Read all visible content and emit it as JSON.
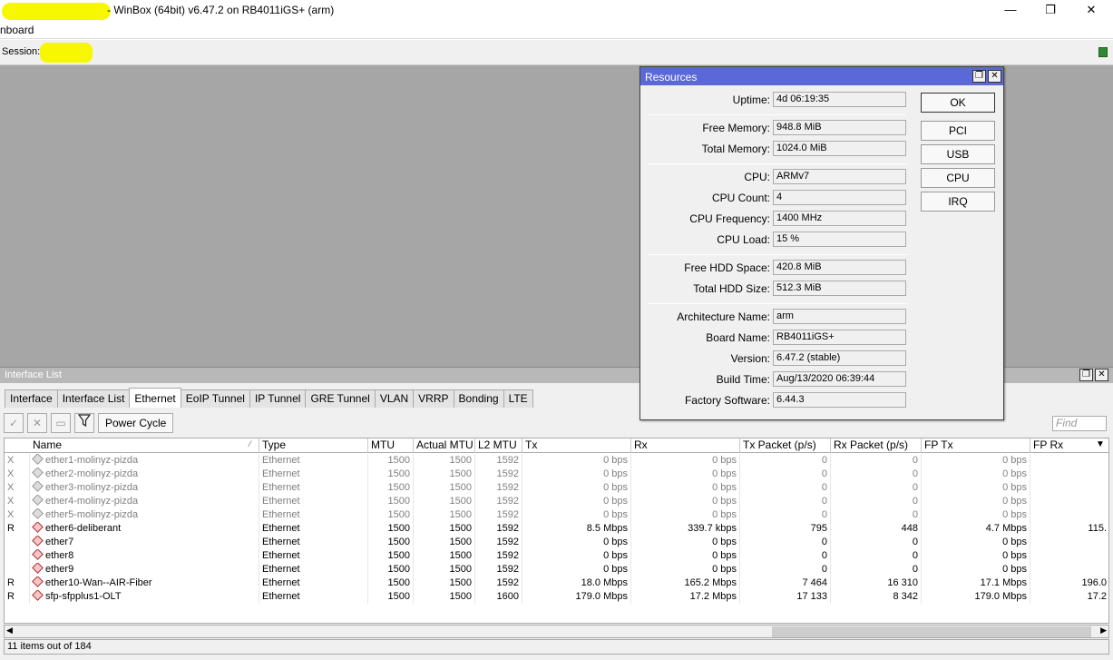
{
  "window": {
    "title": "- WinBox (64bit) v6.47.2 on RB4011iGS+ (arm)",
    "min": "—",
    "max": "❐",
    "close": "✕"
  },
  "menubar": {
    "item": "nboard"
  },
  "session": {
    "label": "Session:"
  },
  "interface_list": {
    "title": "Interface List",
    "tabs": [
      "Interface",
      "Interface List",
      "Ethernet",
      "EoIP Tunnel",
      "IP Tunnel",
      "GRE Tunnel",
      "VLAN",
      "VRRP",
      "Bonding",
      "LTE"
    ],
    "active_tab": "Ethernet",
    "toolbar": {
      "power_cycle": "Power Cycle"
    },
    "find_placeholder": "Find",
    "columns": [
      "Name",
      "Type",
      "MTU",
      "Actual MTU",
      "L2 MTU",
      "Tx",
      "Rx",
      "Tx Packet (p/s)",
      "Rx Packet (p/s)",
      "FP Tx",
      "FP Rx"
    ],
    "rows": [
      {
        "flag": "X",
        "name": "ether1-molinyz-pizda",
        "type": "Ethernet",
        "mtu": "1500",
        "actual_mtu": "1500",
        "l2mtu": "1592",
        "tx": "0 bps",
        "rx": "0 bps",
        "txp": "0",
        "rxp": "0",
        "fptx": "0 bps",
        "fprx": "",
        "disabled": true
      },
      {
        "flag": "X",
        "name": "ether2-molinyz-pizda",
        "type": "Ethernet",
        "mtu": "1500",
        "actual_mtu": "1500",
        "l2mtu": "1592",
        "tx": "0 bps",
        "rx": "0 bps",
        "txp": "0",
        "rxp": "0",
        "fptx": "0 bps",
        "fprx": "",
        "disabled": true
      },
      {
        "flag": "X",
        "name": "ether3-molinyz-pizda",
        "type": "Ethernet",
        "mtu": "1500",
        "actual_mtu": "1500",
        "l2mtu": "1592",
        "tx": "0 bps",
        "rx": "0 bps",
        "txp": "0",
        "rxp": "0",
        "fptx": "0 bps",
        "fprx": "",
        "disabled": true
      },
      {
        "flag": "X",
        "name": "ether4-molinyz-pizda",
        "type": "Ethernet",
        "mtu": "1500",
        "actual_mtu": "1500",
        "l2mtu": "1592",
        "tx": "0 bps",
        "rx": "0 bps",
        "txp": "0",
        "rxp": "0",
        "fptx": "0 bps",
        "fprx": "",
        "disabled": true
      },
      {
        "flag": "X",
        "name": "ether5-molinyz-pizda",
        "type": "Ethernet",
        "mtu": "1500",
        "actual_mtu": "1500",
        "l2mtu": "1592",
        "tx": "0 bps",
        "rx": "0 bps",
        "txp": "0",
        "rxp": "0",
        "fptx": "0 bps",
        "fprx": "",
        "disabled": true
      },
      {
        "flag": "R",
        "name": "ether6-deliberant",
        "type": "Ethernet",
        "mtu": "1500",
        "actual_mtu": "1500",
        "l2mtu": "1592",
        "tx": "8.5 Mbps",
        "rx": "339.7 kbps",
        "txp": "795",
        "rxp": "448",
        "fptx": "4.7 Mbps",
        "fprx": "115.",
        "disabled": false
      },
      {
        "flag": "",
        "name": "ether7",
        "type": "Ethernet",
        "mtu": "1500",
        "actual_mtu": "1500",
        "l2mtu": "1592",
        "tx": "0 bps",
        "rx": "0 bps",
        "txp": "0",
        "rxp": "0",
        "fptx": "0 bps",
        "fprx": "",
        "disabled": false
      },
      {
        "flag": "",
        "name": "ether8",
        "type": "Ethernet",
        "mtu": "1500",
        "actual_mtu": "1500",
        "l2mtu": "1592",
        "tx": "0 bps",
        "rx": "0 bps",
        "txp": "0",
        "rxp": "0",
        "fptx": "0 bps",
        "fprx": "",
        "disabled": false
      },
      {
        "flag": "",
        "name": "ether9",
        "type": "Ethernet",
        "mtu": "1500",
        "actual_mtu": "1500",
        "l2mtu": "1592",
        "tx": "0 bps",
        "rx": "0 bps",
        "txp": "0",
        "rxp": "0",
        "fptx": "0 bps",
        "fprx": "",
        "disabled": false
      },
      {
        "flag": "R",
        "name": "ether10-Wan--AIR-Fiber",
        "type": "Ethernet",
        "mtu": "1500",
        "actual_mtu": "1500",
        "l2mtu": "1592",
        "tx": "18.0 Mbps",
        "rx": "165.2 Mbps",
        "txp": "7 464",
        "rxp": "16 310",
        "fptx": "17.1 Mbps",
        "fprx": "196.0",
        "disabled": false
      },
      {
        "flag": "R",
        "name": "sfp-sfpplus1-OLT",
        "type": "Ethernet",
        "mtu": "1500",
        "actual_mtu": "1500",
        "l2mtu": "1600",
        "tx": "179.0 Mbps",
        "rx": "17.2 Mbps",
        "txp": "17 133",
        "rxp": "8 342",
        "fptx": "179.0 Mbps",
        "fprx": "17.2",
        "disabled": false
      }
    ],
    "status": "11 items out of 184"
  },
  "resources": {
    "title": "Resources",
    "fields": [
      {
        "label": "Uptime:",
        "value": "4d 06:19:35"
      },
      {
        "label": "Free Memory:",
        "value": "948.8 MiB"
      },
      {
        "label": "Total Memory:",
        "value": "1024.0 MiB"
      },
      {
        "label": "CPU:",
        "value": "ARMv7"
      },
      {
        "label": "CPU Count:",
        "value": "4"
      },
      {
        "label": "CPU Frequency:",
        "value": "1400 MHz"
      },
      {
        "label": "CPU Load:",
        "value": "15 %"
      },
      {
        "label": "Free HDD Space:",
        "value": "420.8 MiB"
      },
      {
        "label": "Total HDD Size:",
        "value": "512.3 MiB"
      },
      {
        "label": "Architecture Name:",
        "value": "arm"
      },
      {
        "label": "Board Name:",
        "value": "RB4011iGS+"
      },
      {
        "label": "Version:",
        "value": "6.47.2 (stable)"
      },
      {
        "label": "Build Time:",
        "value": "Aug/13/2020 06:39:44"
      },
      {
        "label": "Factory Software:",
        "value": "6.44.3"
      }
    ],
    "buttons": [
      "OK",
      "PCI",
      "USB",
      "CPU",
      "IRQ"
    ]
  },
  "colors": {
    "accent": "#5b69d8",
    "workspace": "#a6a6a6",
    "led": "#2f8a2f"
  }
}
